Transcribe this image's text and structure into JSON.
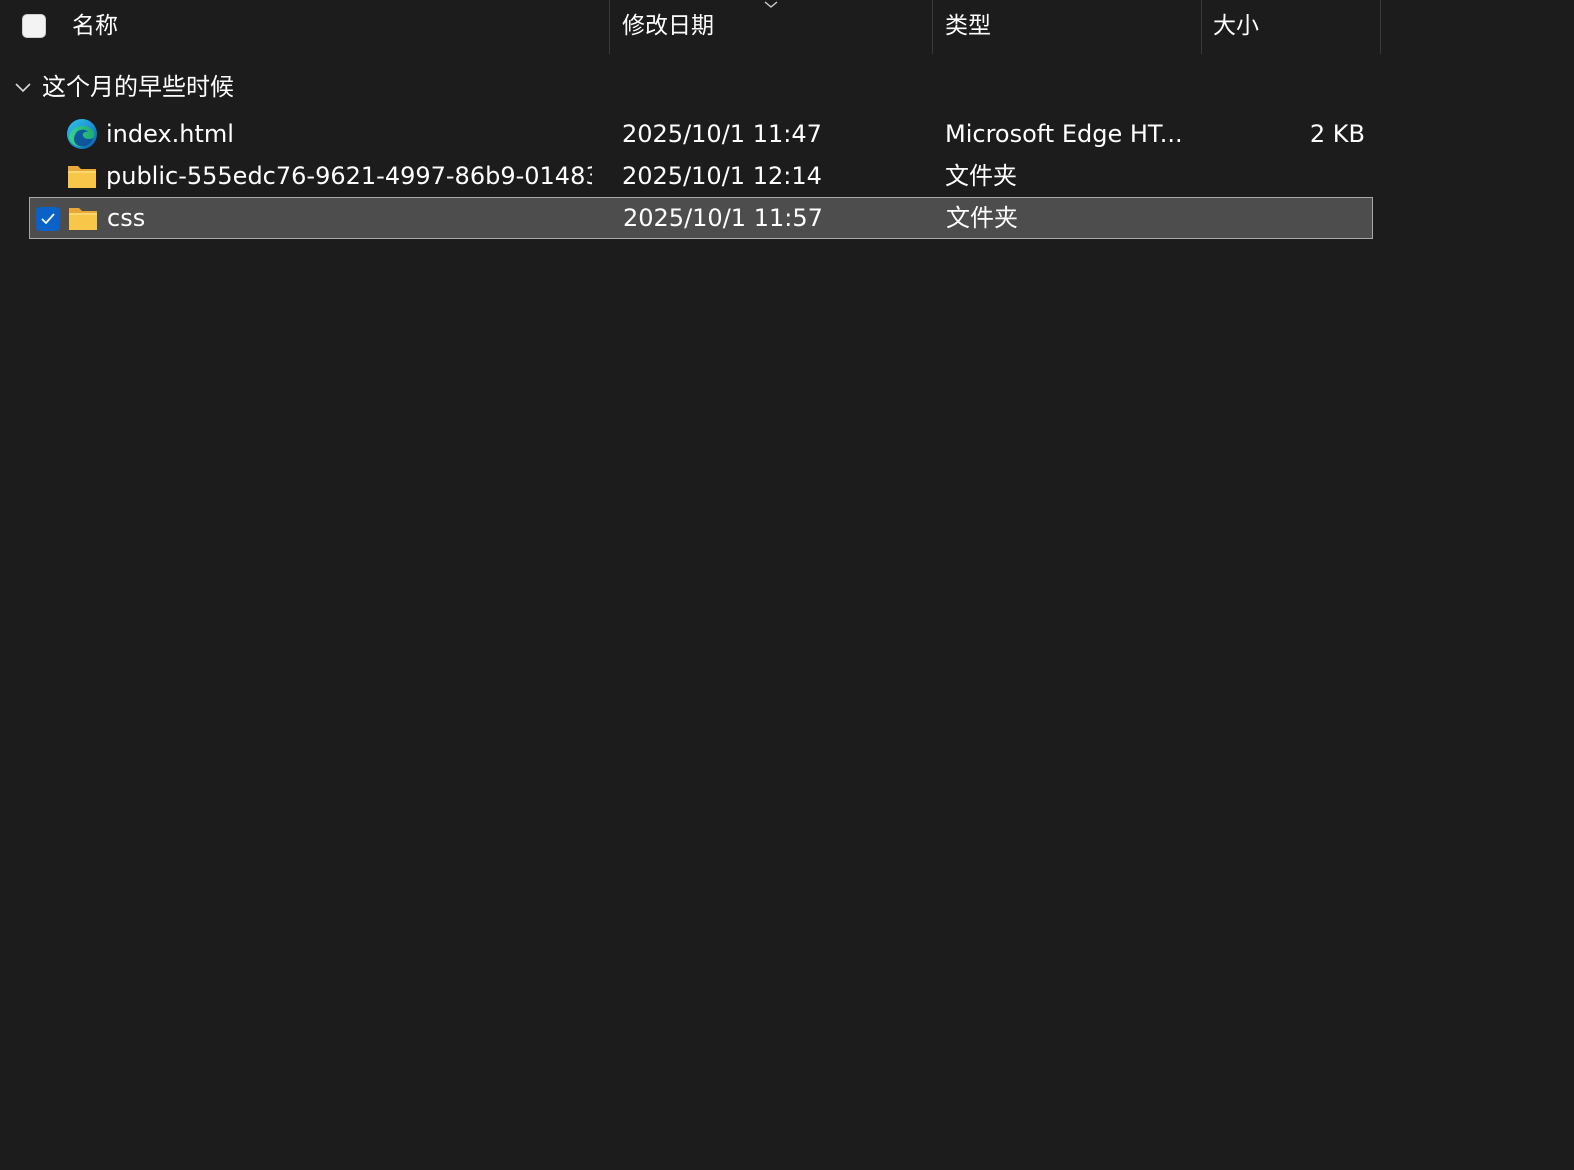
{
  "header": {
    "select_all_checked": false,
    "columns": {
      "name": "名称",
      "date": "修改日期",
      "type": "类型",
      "size": "大小"
    },
    "sort_indicator_icon": "chevron-down-icon"
  },
  "group": {
    "title": "这个月的早些时候",
    "expanded": true
  },
  "files": [
    {
      "name": "index.html",
      "date": "2025/10/1 11:47",
      "type": "Microsoft Edge HT...",
      "size": "2 KB",
      "icon": "edge-icon",
      "selected": false
    },
    {
      "name": "public-555edc76-9621-4997-86b9-01483...",
      "date": "2025/10/1 12:14",
      "type": "文件夹",
      "size": "",
      "icon": "folder-icon",
      "selected": false
    },
    {
      "name": "css",
      "date": "2025/10/1 11:57",
      "type": "文件夹",
      "size": "",
      "icon": "folder-icon",
      "selected": true
    }
  ],
  "colors": {
    "background": "#1c1c1c",
    "selection": "#4d4d4d",
    "selection_border": "#a8a8a8",
    "checkbox_accent": "#0a62c9",
    "folder": "#f8c74a"
  }
}
